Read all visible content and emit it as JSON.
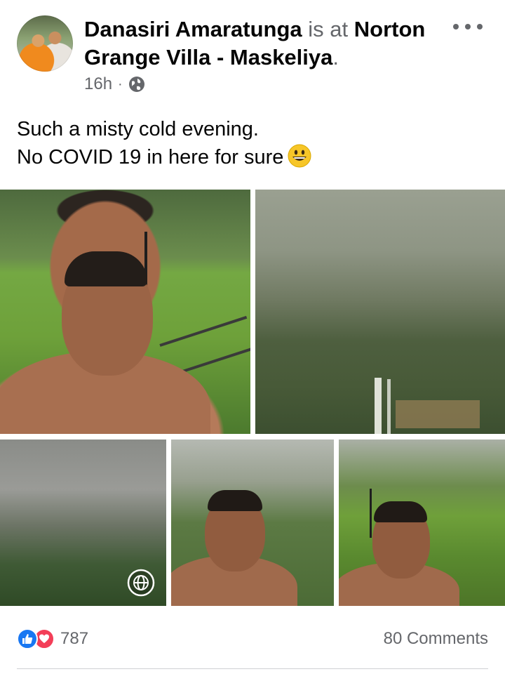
{
  "post": {
    "author": "Danasiri Amaratunga",
    "connector": "is at",
    "place_line1": "Norton",
    "place_line2": "Grange Villa - Maskeliya",
    "place_suffix": ".",
    "time": "16h",
    "separator": "·",
    "privacy_icon": "globe-icon",
    "more_icon": "more-options-icon",
    "caption_lines": [
      "Such a misty cold evening.",
      "No COVID 19 in here for sure"
    ],
    "caption_emoji": "grinning-face-emoji"
  },
  "photos": {
    "count": 5,
    "p3_overlay_icon": "360-photo-icon"
  },
  "footer": {
    "reaction_icons": [
      "like-icon",
      "love-icon"
    ],
    "reaction_count": "787",
    "comments_label": "80 Comments"
  },
  "colors": {
    "like_blue": "#1877f2",
    "love_red": "#f33e58",
    "secondary_text": "#65676b"
  }
}
